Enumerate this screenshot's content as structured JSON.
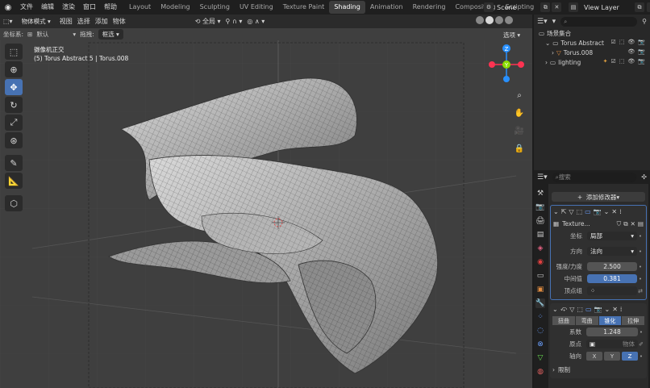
{
  "menu": [
    "文件",
    "编辑",
    "渲染",
    "窗口",
    "帮助"
  ],
  "workspace_tabs": [
    {
      "label": "Layout",
      "active": false
    },
    {
      "label": "Modeling",
      "active": false
    },
    {
      "label": "Sculpting",
      "active": false
    },
    {
      "label": "UV Editing",
      "active": false
    },
    {
      "label": "Texture Paint",
      "active": false
    },
    {
      "label": "Shading",
      "active": true
    },
    {
      "label": "Animation",
      "active": false
    },
    {
      "label": "Rendering",
      "active": false
    },
    {
      "label": "Compositing",
      "active": false
    },
    {
      "label": "Scripting",
      "active": false
    }
  ],
  "scene": {
    "label": "Scene"
  },
  "view_layer": {
    "label": "View Layer"
  },
  "viewport": {
    "mode": "物体模式",
    "menus": [
      "视图",
      "选择",
      "添加",
      "物体"
    ],
    "transform_orientation": "全局",
    "coord_label": "坐标系:",
    "coord_value": "默认",
    "drag_label": "拖拽:",
    "drag_value": "框选",
    "options": "选项",
    "camera_title": "摄像机正交",
    "camera_sub": "(5) Torus Abstract 5 | Torus.008"
  },
  "outliner": {
    "search_placeholder": "",
    "root": "场景集合",
    "items": [
      {
        "label": "Torus Abstract",
        "indent": 1
      },
      {
        "label": "Torus.008",
        "indent": 2
      },
      {
        "label": "lighting",
        "indent": 1
      }
    ]
  },
  "properties": {
    "search_placeholder": "搜索",
    "add_modifier": "添加修改器",
    "texture_name": "Texture...",
    "coord_label": "坐标",
    "coord_value": "局部",
    "direction_label": "方向",
    "direction_value": "法向",
    "strength_label": "强度/力度",
    "strength_value": "2.500",
    "midlevel_label": "中间值",
    "midlevel_value": "0.381",
    "vgroup_label": "顶点组",
    "deform_tabs": [
      "扭曲",
      "弯曲",
      "锥化",
      "拉伸"
    ],
    "deform_selected": 2,
    "factor_label": "系数",
    "factor_value": "1.248",
    "origin_label": "原点",
    "origin_placeholder": "物体",
    "axis_label": "轴向",
    "axes": [
      "X",
      "Y",
      "Z"
    ],
    "axis_selected": 2,
    "limits_label": "限制"
  },
  "gizmo": {
    "x": "X",
    "y": "Y",
    "z": "Z"
  },
  "colors": {
    "accent": "#4772b3",
    "viewport": "#3f3f3f",
    "x_axis": "#ff3352",
    "y_axis": "#8bdc00",
    "z_axis": "#2890ff"
  }
}
